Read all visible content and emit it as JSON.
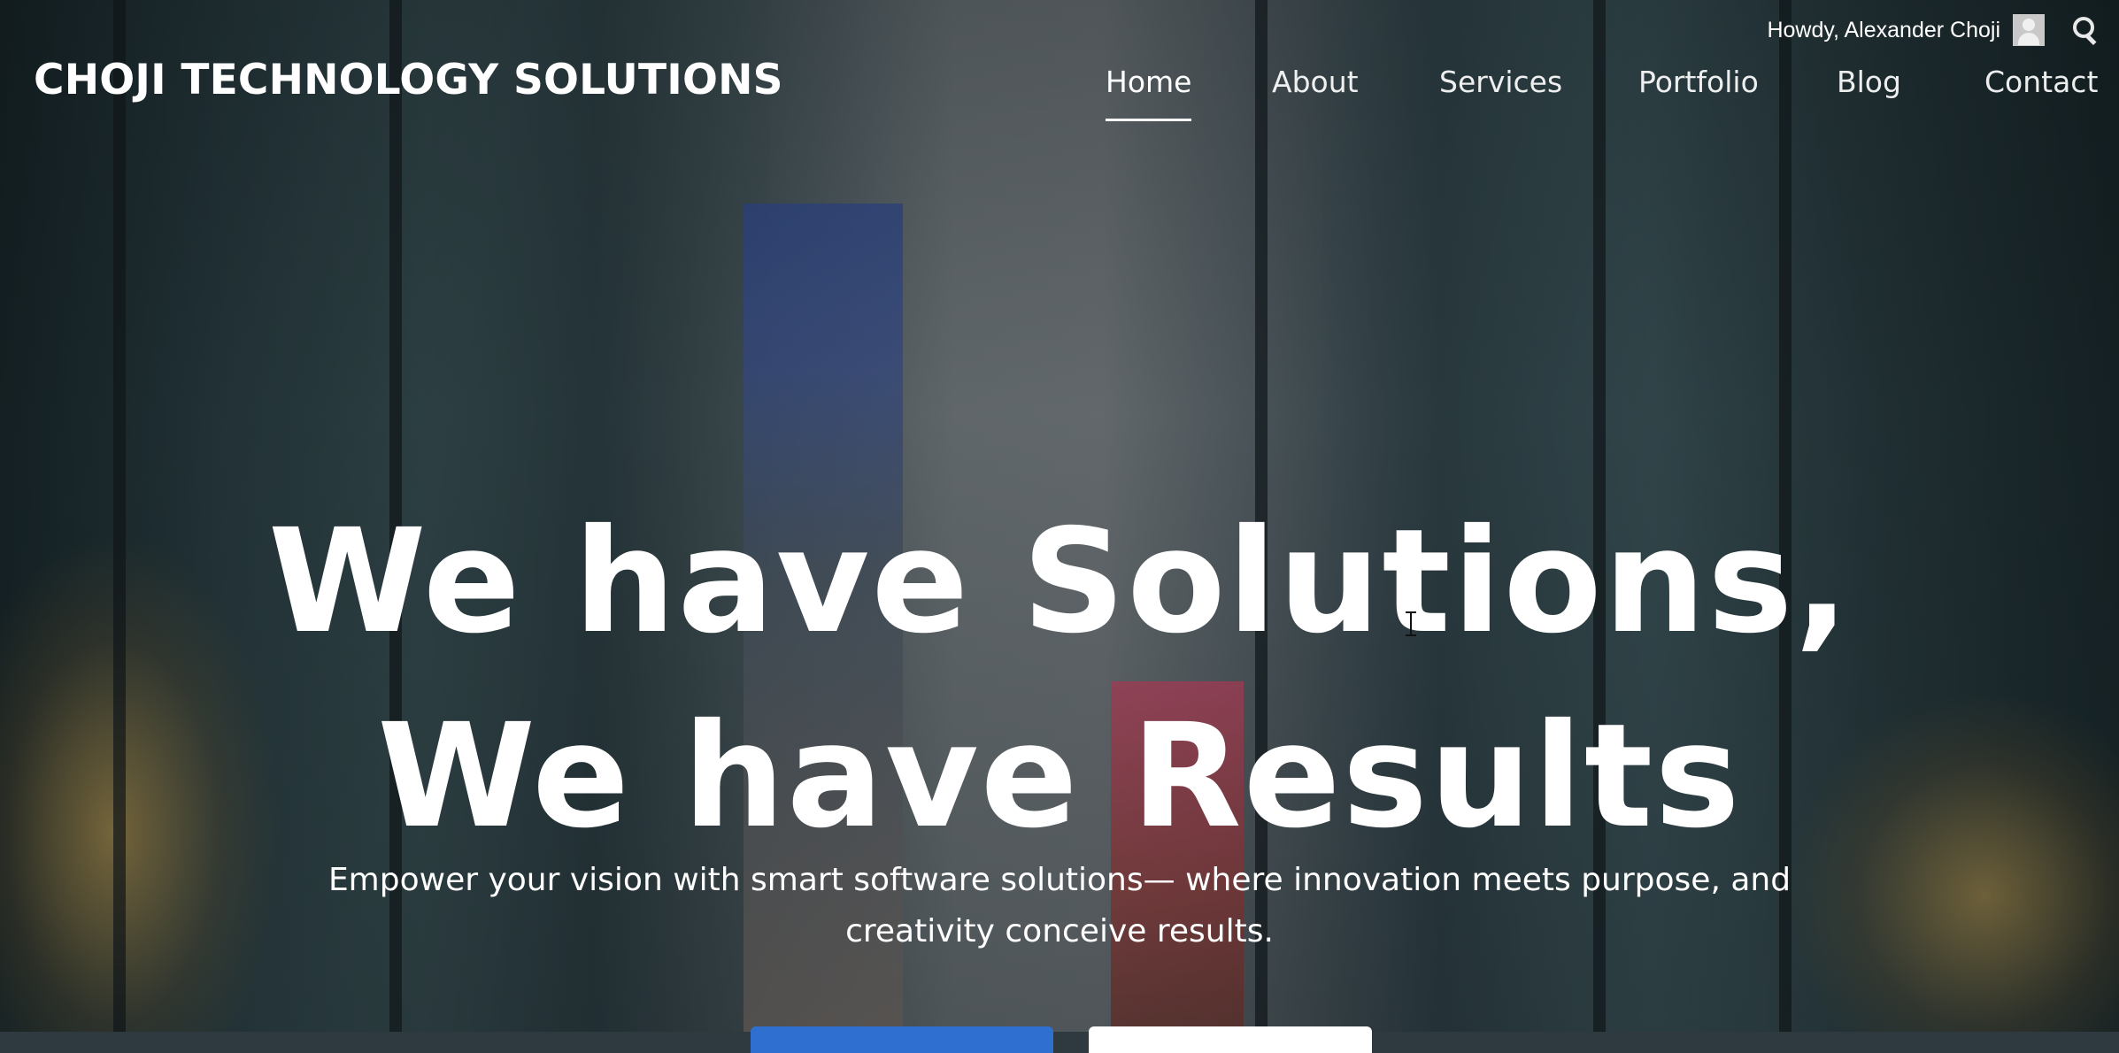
{
  "admin_bar": {
    "greeting": "Howdy, Alexander Choji",
    "avatar_icon": "user-avatar-icon",
    "search_icon": "search-icon"
  },
  "header": {
    "brand": "CHOJI TECHNOLOGY SOLUTIONS",
    "nav": [
      {
        "label": "Home",
        "active": true
      },
      {
        "label": "About",
        "active": false
      },
      {
        "label": "Services",
        "active": false
      },
      {
        "label": "Portfolio",
        "active": false
      },
      {
        "label": "Blog",
        "active": false
      },
      {
        "label": "Contact",
        "active": false
      }
    ]
  },
  "hero": {
    "headline_line1": "We have Solutions,",
    "headline_line2": "We have Results",
    "subtitle": "Empower your vision with smart software solutions— where innovation meets purpose, and creativity conceive results.",
    "primary_button_color": "#2e6fd0",
    "secondary_button_color": "#ffffff"
  }
}
